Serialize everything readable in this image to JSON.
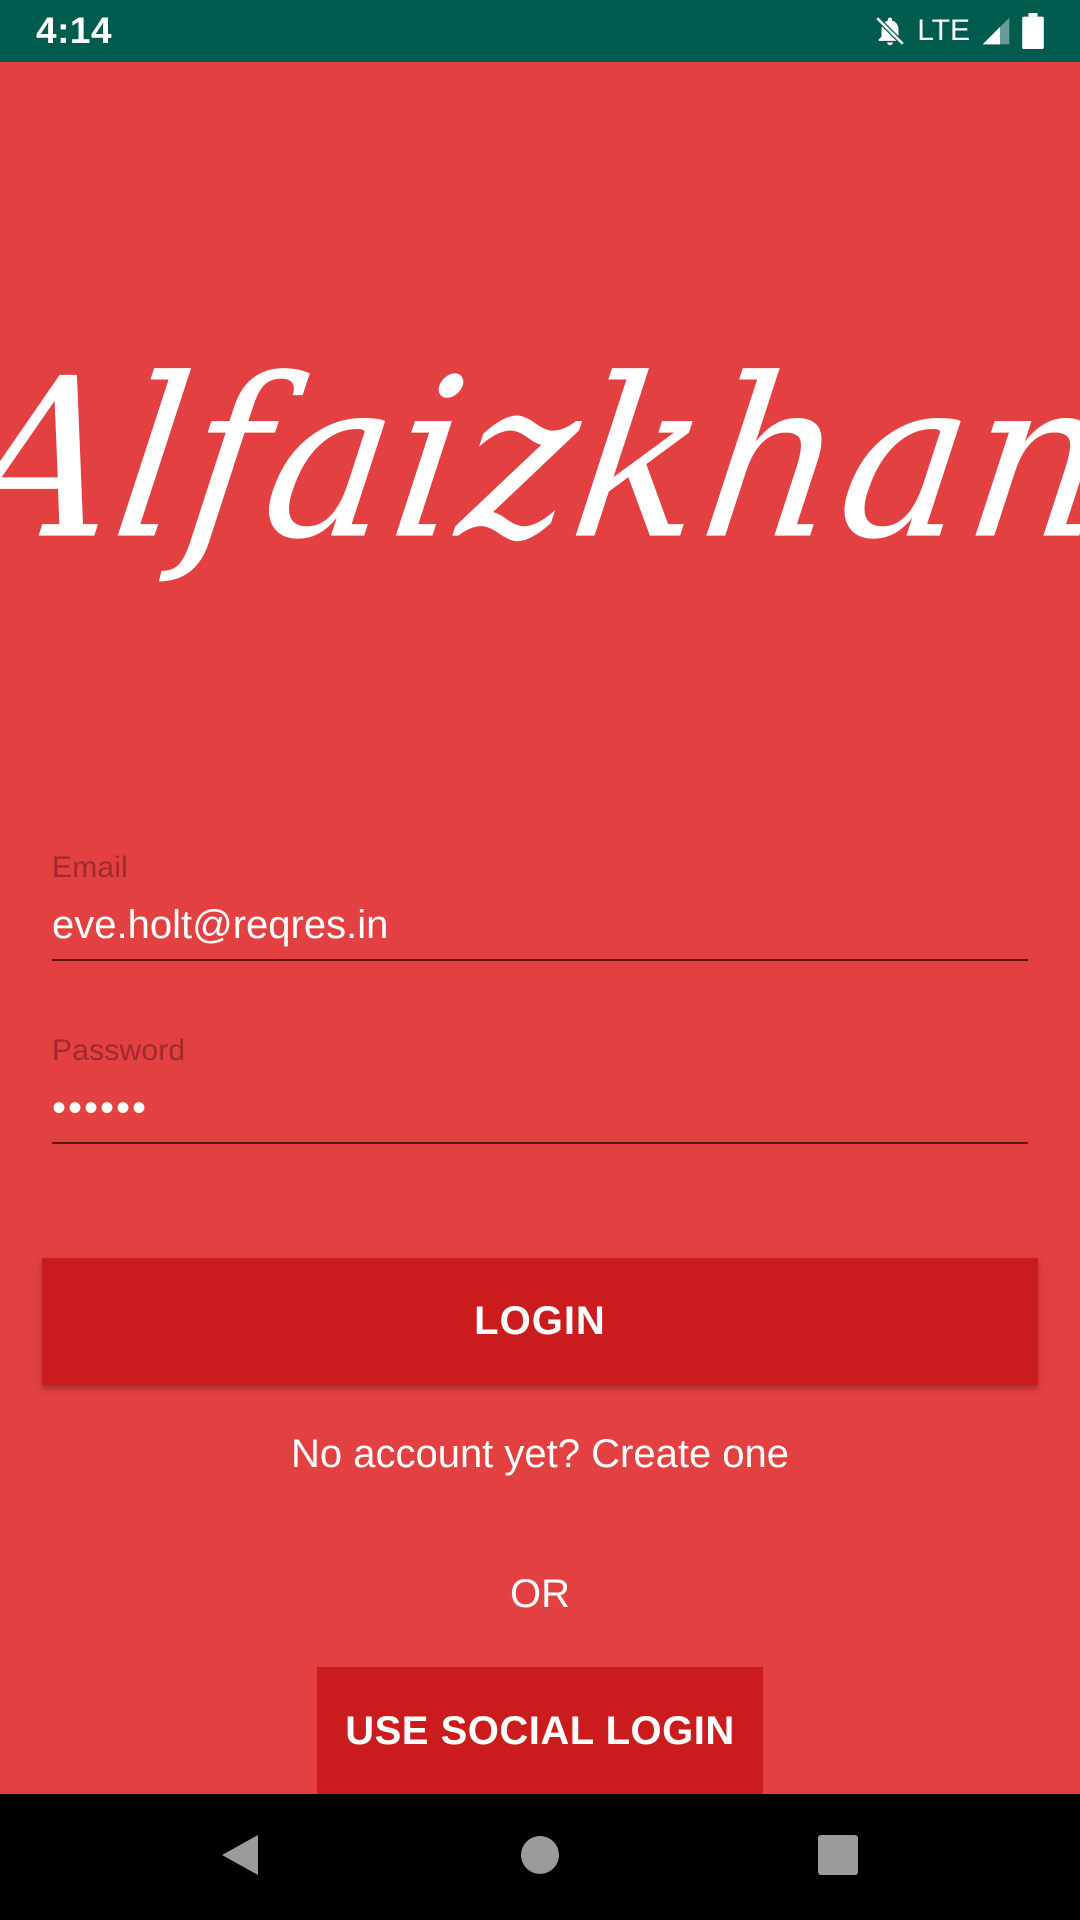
{
  "status_bar": {
    "time": "4:14",
    "network": "LTE",
    "icons": [
      "notifications-off-icon",
      "signal-icon",
      "battery-icon"
    ]
  },
  "logo": {
    "text": "Alfaizkhan"
  },
  "form": {
    "email": {
      "label": "Email",
      "value": "eve.holt@reqres.in"
    },
    "password": {
      "label": "Password",
      "value": "••••••"
    }
  },
  "buttons": {
    "login": "LOGIN",
    "create_account": "No account yet? Create one",
    "or": "OR",
    "social_login": "USE SOCIAL LOGIN"
  },
  "nav": {
    "icons": [
      "back-icon",
      "home-icon",
      "recents-icon"
    ]
  },
  "colors": {
    "background": "#E34042",
    "status_bar": "#005B4F",
    "button": "#CA1C1D",
    "label": "#9E2A2D"
  }
}
